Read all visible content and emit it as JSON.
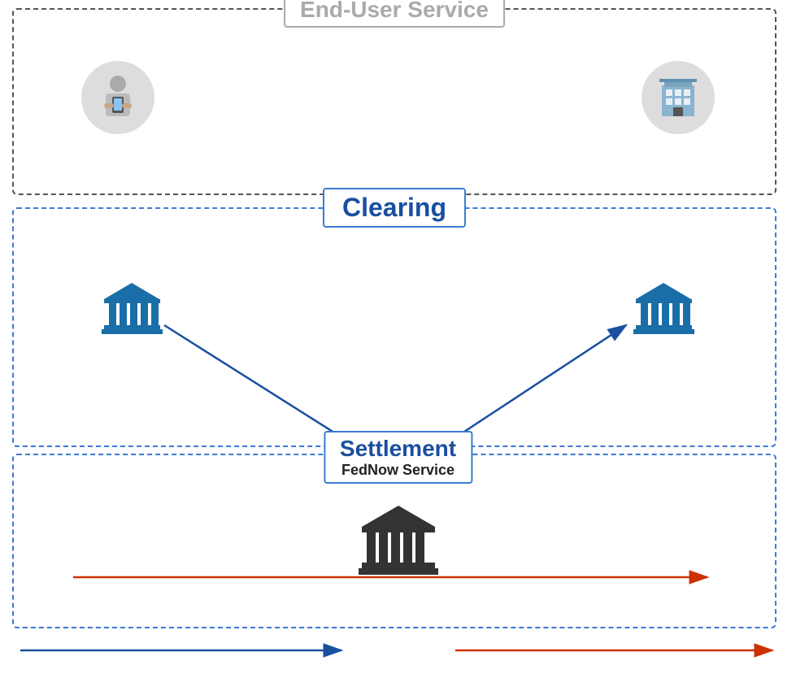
{
  "diagram": {
    "end_user_service_label": "End-User Service",
    "clearing_label": "Clearing",
    "settlement_label": "Settlement",
    "fednow_label": "FedNow Service",
    "colors": {
      "dashed_dark": "#666",
      "dashed_blue": "#3a7bd5",
      "bank_blue": "#1a6ea8",
      "arrow_blue": "#1a4fa0",
      "arrow_red": "#cc2200",
      "label_gray": "#aaa",
      "label_blue": "#1a4fa0"
    }
  }
}
